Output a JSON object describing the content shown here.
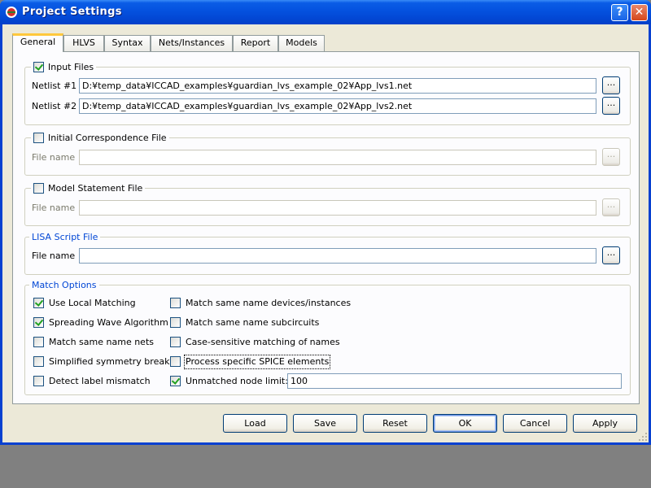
{
  "window": {
    "title": "Project Settings"
  },
  "tabs": [
    "General",
    "HLVS",
    "Syntax",
    "Nets/Instances",
    "Report",
    "Models"
  ],
  "input_files": {
    "legend": "Input Files",
    "checked": true,
    "netlist1_label": "Netlist #1",
    "netlist1_value": "D:¥temp_data¥ICCAD_examples¥guardian_lvs_example_02¥App_lvs1.net",
    "netlist2_label": "Netlist #2",
    "netlist2_value": "D:¥temp_data¥ICCAD_examples¥guardian_lvs_example_02¥App_lvs2.net"
  },
  "initial_correspondence": {
    "legend": "Initial Correspondence File",
    "checked": false,
    "file_label": "File name",
    "value": ""
  },
  "model_statement": {
    "legend": "Model Statement File",
    "checked": false,
    "file_label": "File name",
    "value": ""
  },
  "lisa_script": {
    "legend": "LISA Script File",
    "file_label": "File name",
    "value": ""
  },
  "browse_label": "...",
  "match_options": {
    "legend": "Match Options",
    "left": [
      {
        "label": "Use Local Matching",
        "checked": true
      },
      {
        "label": "Spreading Wave Algorithm",
        "checked": true
      },
      {
        "label": "Match same name nets",
        "checked": false
      },
      {
        "label": "Simplified symmetry break",
        "checked": false
      },
      {
        "label": "Detect label mismatch",
        "checked": false
      }
    ],
    "right": [
      {
        "label": "Match same name devices/instances",
        "checked": false
      },
      {
        "label": "Match same name subcircuits",
        "checked": false
      },
      {
        "label": "Case-sensitive matching of names",
        "checked": false
      },
      {
        "label": "Process specific SPICE elements",
        "checked": false
      },
      {
        "label": "Unmatched node limit:",
        "checked": true
      }
    ],
    "node_limit_value": "100"
  },
  "buttons": {
    "load": "Load",
    "save": "Save",
    "reset": "Reset",
    "ok": "OK",
    "cancel": "Cancel",
    "apply": "Apply"
  }
}
